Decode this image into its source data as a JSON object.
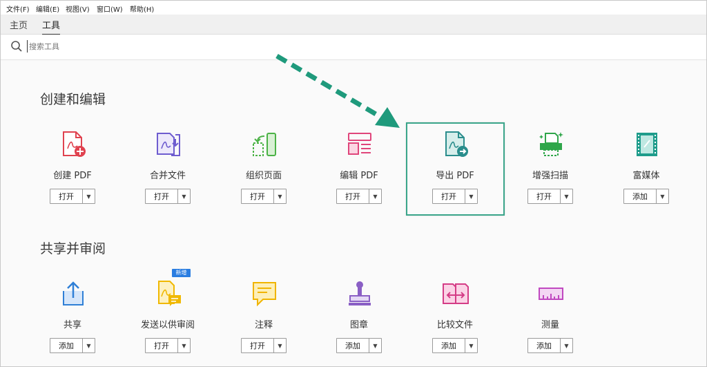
{
  "menu": [
    "文件(F)",
    "编辑(E)",
    "视图(V)",
    "窗口(W)",
    "帮助(H)"
  ],
  "tabs": {
    "home": "主页",
    "tools": "工具"
  },
  "search": {
    "placeholder": "搜索工具"
  },
  "sections": {
    "create": {
      "title": "创建和编辑",
      "tools": [
        {
          "label": "创建 PDF",
          "button": "打开",
          "icon": "create-pdf-icon"
        },
        {
          "label": "合并文件",
          "button": "打开",
          "icon": "combine-files-icon"
        },
        {
          "label": "组织页面",
          "button": "打开",
          "icon": "organize-pages-icon"
        },
        {
          "label": "编辑 PDF",
          "button": "打开",
          "icon": "edit-pdf-icon"
        },
        {
          "label": "导出 PDF",
          "button": "打开",
          "icon": "export-pdf-icon"
        },
        {
          "label": "增强扫描",
          "button": "打开",
          "icon": "enhance-scan-icon"
        },
        {
          "label": "富媒体",
          "button": "添加",
          "icon": "rich-media-icon"
        }
      ]
    },
    "share": {
      "title": "共享并审阅",
      "tools": [
        {
          "label": "共享",
          "button": "添加",
          "icon": "share-icon"
        },
        {
          "label": "发送以供审阅",
          "button": "打开",
          "icon": "send-for-review-icon"
        },
        {
          "label": "注释",
          "button": "打开",
          "icon": "comment-icon"
        },
        {
          "label": "图章",
          "button": "添加",
          "icon": "stamp-icon"
        },
        {
          "label": "比较文件",
          "button": "添加",
          "icon": "compare-files-icon"
        },
        {
          "label": "测量",
          "button": "添加",
          "icon": "measure-icon"
        }
      ]
    }
  },
  "new_badge": "新增",
  "colors": {
    "accent_teal": "#3aa58a",
    "create_red": "#e0424f",
    "combine_purple": "#6e5ccf",
    "organize_green": "#4bb246",
    "edit_pink": "#e0457b",
    "export_teal": "#2a8d8c",
    "scan_green": "#2fa64a",
    "media_teal": "#1e9c8b",
    "share_blue": "#2f7fd6",
    "review_yellow": "#f0b800",
    "comment_yellow": "#f0b400",
    "stamp_purple": "#8a5fc5",
    "compare_pink": "#d43c86",
    "measure_magenta": "#c048c0"
  }
}
